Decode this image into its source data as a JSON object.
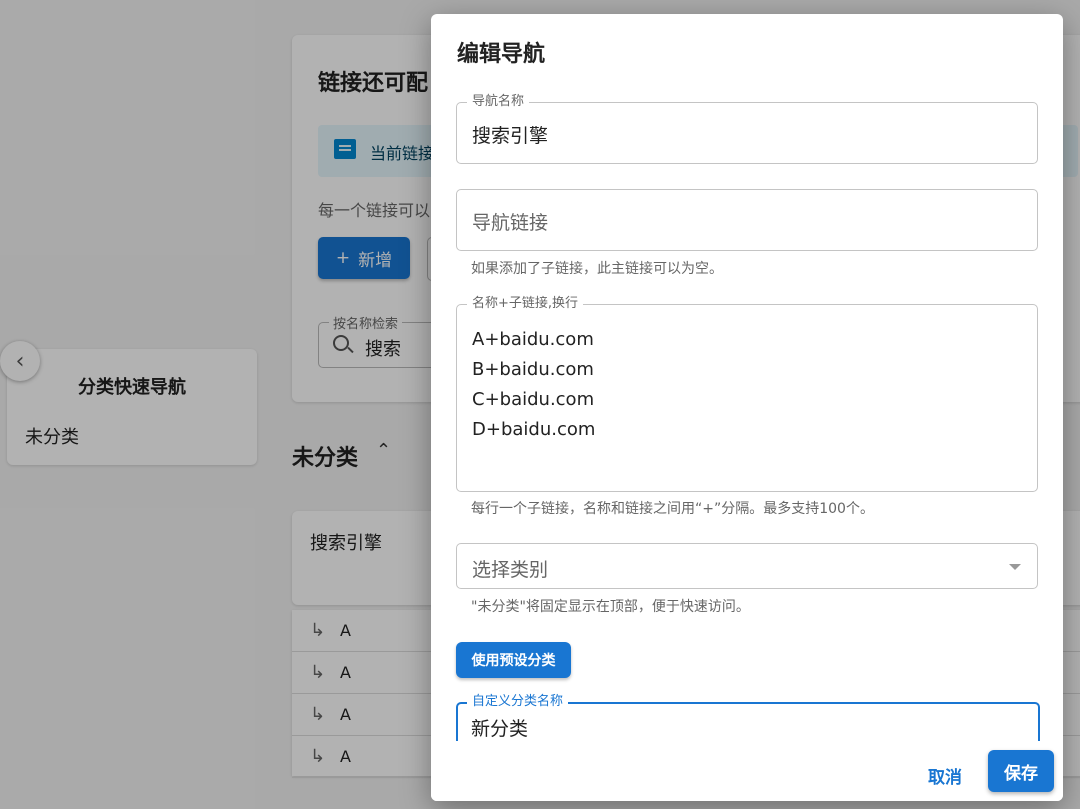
{
  "background": {
    "collapse_icon": "chevron-left-icon",
    "category_nav": {
      "title": "分类快速导航",
      "item": "未分类"
    },
    "top_card": {
      "heading": "链接还可配",
      "alert_text": "当前链接",
      "description": "每一个链接可以",
      "add_button": "新增",
      "search_label": "按名称检索",
      "search_value": "搜索"
    },
    "section_title": "未分类",
    "nav_card_title": "搜索引擎",
    "sub_rows": [
      {
        "label": "A"
      },
      {
        "label": "A"
      },
      {
        "label": "A"
      },
      {
        "label": "A"
      }
    ]
  },
  "dialog": {
    "title": "编辑导航",
    "name_field": {
      "label": "导航名称",
      "value": "搜索引擎"
    },
    "link_field": {
      "placeholder": "导航链接",
      "helper": "如果添加了子链接，此主链接可以为空。"
    },
    "sublinks_field": {
      "label": "名称+子链接,换行",
      "lines": [
        "A+baidu.com",
        "B+baidu.com",
        "C+baidu.com",
        "D+baidu.com"
      ],
      "helper": "每行一个子链接，名称和链接之间用“+”分隔。最多支持100个。"
    },
    "category_select": {
      "placeholder": "选择类别",
      "helper": "\"未分类\"将固定显示在顶部，便于快速访问。"
    },
    "preset_button": "使用预设分类",
    "custom_category": {
      "label": "自定义分类名称",
      "value": "新分类"
    },
    "cancel_button": "取消",
    "save_button": "保存"
  },
  "colors": {
    "primary": "#1976d2",
    "overlay": "rgba(0,0,0,0.30)"
  }
}
